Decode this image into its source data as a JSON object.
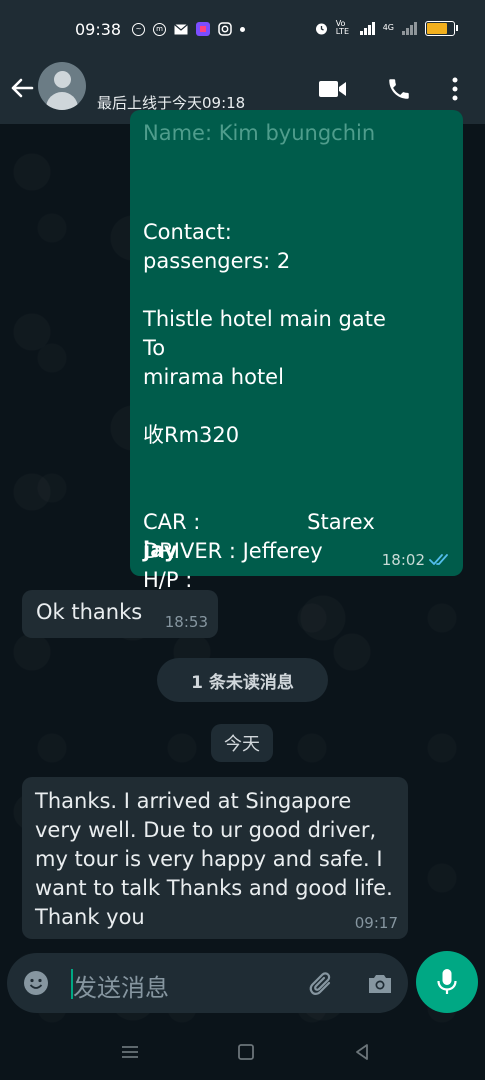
{
  "status_bar": {
    "time": "09:38",
    "volte_label": "Vo LTE",
    "network_label": "4G",
    "battery_level": 0.85,
    "battery_color": "#f2b01e"
  },
  "header": {
    "last_seen": "最后上线于今天09:18"
  },
  "messages": {
    "outgoing": {
      "partial_line": "Name: Kim byungchin",
      "lines": [
        "Contact:",
        "passengers: 2",
        "",
        "Thistle hotel main gate",
        "To",
        "mirama hotel",
        "",
        "收Rm320",
        "",
        "",
        "CAR :                Starex",
        "DRIVER : Jefferey",
        "H/P :"
      ],
      "sender": "jay",
      "time": "18:02"
    },
    "incoming_1": {
      "text": "Ok thanks",
      "time": "18:53"
    },
    "unread_label": "1 条未读消息",
    "date_label": "今天",
    "incoming_2": {
      "text": "Thanks.  I arrived at Singapore very well. Due to ur good driver, my tour is very happy and safe.  I want to talk Thanks and good life.  Thank you",
      "time": "09:17"
    }
  },
  "input": {
    "placeholder": "发送消息"
  },
  "colors": {
    "outgoing_bubble": "#005c4b",
    "incoming_bubble": "#202c33",
    "accent": "#00a884",
    "read_ticks": "#53bdeb"
  }
}
